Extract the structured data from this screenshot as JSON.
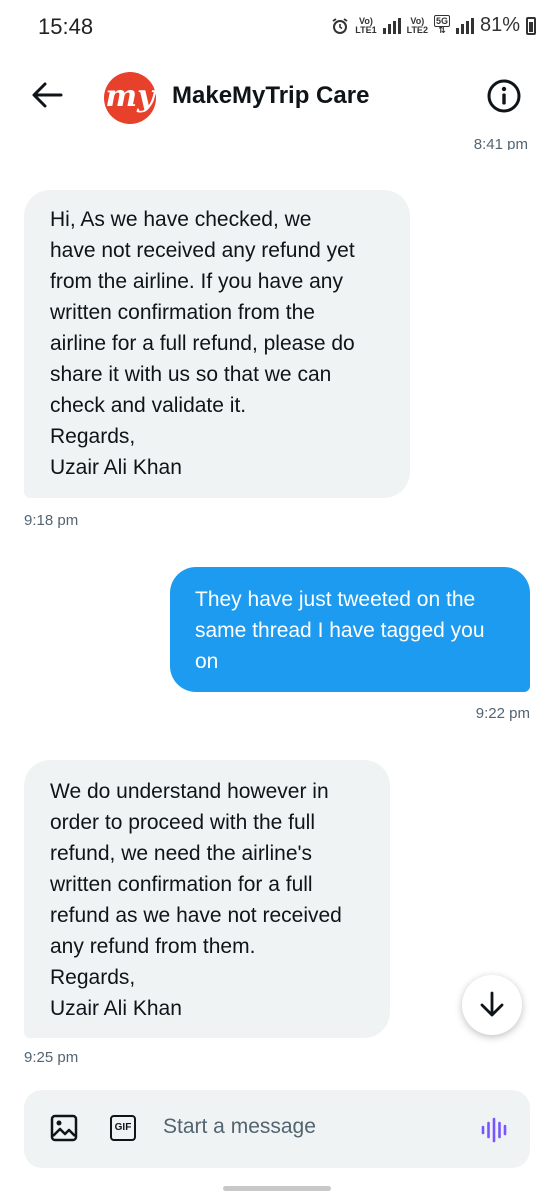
{
  "status_bar": {
    "time": "15:48",
    "sim1": "LTE1",
    "sim2": "LTE2",
    "network_5g": "5G",
    "battery": "81%"
  },
  "header": {
    "title": "MakeMyTrip Care",
    "logo_text": "my",
    "back_icon": "arrow-left-icon",
    "info_icon": "info-icon"
  },
  "messages": [
    {
      "type": "timestamp",
      "text": "8:41 pm"
    },
    {
      "type": "incoming",
      "text": "Hi, As we have checked, we\nhave not received any refund yet\nfrom the airline. If you have any\nwritten confirmation from the\nairline for a full refund, please do\nshare it with us so that we can\ncheck and validate it.\nRegards,\nUzair Ali Khan",
      "time": "9:18 pm"
    },
    {
      "type": "outgoing",
      "text": "They have just tweeted on the\nsame thread I have tagged you\non",
      "time": "9:22 pm"
    },
    {
      "type": "incoming",
      "text": "We do understand however in\norder to proceed with the full\nrefund, we need the airline's\nwritten confirmation for a full\nrefund as we have not received\nany refund from them.\nRegards,\nUzair Ali Khan",
      "time": "9:25 pm"
    }
  ],
  "composer": {
    "placeholder": "Start a message",
    "gif_label": "GIF",
    "image_icon": "image-icon",
    "voice_icon": "voice-waveform-icon"
  },
  "colors": {
    "accent": "#1d9bf0",
    "incoming_bubble": "#eff3f4",
    "logo_red": "#e7412c"
  }
}
